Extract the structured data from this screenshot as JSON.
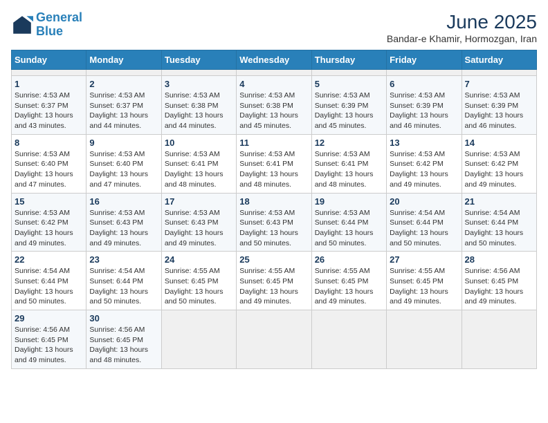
{
  "header": {
    "logo_line1": "General",
    "logo_line2": "Blue",
    "title": "June 2025",
    "subtitle": "Bandar-e Khamir, Hormozgan, Iran"
  },
  "calendar": {
    "days_of_week": [
      "Sunday",
      "Monday",
      "Tuesday",
      "Wednesday",
      "Thursday",
      "Friday",
      "Saturday"
    ],
    "weeks": [
      [
        {
          "day": "",
          "empty": true
        },
        {
          "day": "",
          "empty": true
        },
        {
          "day": "",
          "empty": true
        },
        {
          "day": "",
          "empty": true
        },
        {
          "day": "",
          "empty": true
        },
        {
          "day": "",
          "empty": true
        },
        {
          "day": "",
          "empty": true
        }
      ],
      [
        {
          "day": "1",
          "sunrise": "Sunrise: 4:53 AM",
          "sunset": "Sunset: 6:37 PM",
          "daylight": "Daylight: 13 hours and 43 minutes."
        },
        {
          "day": "2",
          "sunrise": "Sunrise: 4:53 AM",
          "sunset": "Sunset: 6:37 PM",
          "daylight": "Daylight: 13 hours and 44 minutes."
        },
        {
          "day": "3",
          "sunrise": "Sunrise: 4:53 AM",
          "sunset": "Sunset: 6:38 PM",
          "daylight": "Daylight: 13 hours and 44 minutes."
        },
        {
          "day": "4",
          "sunrise": "Sunrise: 4:53 AM",
          "sunset": "Sunset: 6:38 PM",
          "daylight": "Daylight: 13 hours and 45 minutes."
        },
        {
          "day": "5",
          "sunrise": "Sunrise: 4:53 AM",
          "sunset": "Sunset: 6:39 PM",
          "daylight": "Daylight: 13 hours and 45 minutes."
        },
        {
          "day": "6",
          "sunrise": "Sunrise: 4:53 AM",
          "sunset": "Sunset: 6:39 PM",
          "daylight": "Daylight: 13 hours and 46 minutes."
        },
        {
          "day": "7",
          "sunrise": "Sunrise: 4:53 AM",
          "sunset": "Sunset: 6:39 PM",
          "daylight": "Daylight: 13 hours and 46 minutes."
        }
      ],
      [
        {
          "day": "8",
          "sunrise": "Sunrise: 4:53 AM",
          "sunset": "Sunset: 6:40 PM",
          "daylight": "Daylight: 13 hours and 47 minutes."
        },
        {
          "day": "9",
          "sunrise": "Sunrise: 4:53 AM",
          "sunset": "Sunset: 6:40 PM",
          "daylight": "Daylight: 13 hours and 47 minutes."
        },
        {
          "day": "10",
          "sunrise": "Sunrise: 4:53 AM",
          "sunset": "Sunset: 6:41 PM",
          "daylight": "Daylight: 13 hours and 48 minutes."
        },
        {
          "day": "11",
          "sunrise": "Sunrise: 4:53 AM",
          "sunset": "Sunset: 6:41 PM",
          "daylight": "Daylight: 13 hours and 48 minutes."
        },
        {
          "day": "12",
          "sunrise": "Sunrise: 4:53 AM",
          "sunset": "Sunset: 6:41 PM",
          "daylight": "Daylight: 13 hours and 48 minutes."
        },
        {
          "day": "13",
          "sunrise": "Sunrise: 4:53 AM",
          "sunset": "Sunset: 6:42 PM",
          "daylight": "Daylight: 13 hours and 49 minutes."
        },
        {
          "day": "14",
          "sunrise": "Sunrise: 4:53 AM",
          "sunset": "Sunset: 6:42 PM",
          "daylight": "Daylight: 13 hours and 49 minutes."
        }
      ],
      [
        {
          "day": "15",
          "sunrise": "Sunrise: 4:53 AM",
          "sunset": "Sunset: 6:42 PM",
          "daylight": "Daylight: 13 hours and 49 minutes."
        },
        {
          "day": "16",
          "sunrise": "Sunrise: 4:53 AM",
          "sunset": "Sunset: 6:43 PM",
          "daylight": "Daylight: 13 hours and 49 minutes."
        },
        {
          "day": "17",
          "sunrise": "Sunrise: 4:53 AM",
          "sunset": "Sunset: 6:43 PM",
          "daylight": "Daylight: 13 hours and 49 minutes."
        },
        {
          "day": "18",
          "sunrise": "Sunrise: 4:53 AM",
          "sunset": "Sunset: 6:43 PM",
          "daylight": "Daylight: 13 hours and 50 minutes."
        },
        {
          "day": "19",
          "sunrise": "Sunrise: 4:53 AM",
          "sunset": "Sunset: 6:44 PM",
          "daylight": "Daylight: 13 hours and 50 minutes."
        },
        {
          "day": "20",
          "sunrise": "Sunrise: 4:54 AM",
          "sunset": "Sunset: 6:44 PM",
          "daylight": "Daylight: 13 hours and 50 minutes."
        },
        {
          "day": "21",
          "sunrise": "Sunrise: 4:54 AM",
          "sunset": "Sunset: 6:44 PM",
          "daylight": "Daylight: 13 hours and 50 minutes."
        }
      ],
      [
        {
          "day": "22",
          "sunrise": "Sunrise: 4:54 AM",
          "sunset": "Sunset: 6:44 PM",
          "daylight": "Daylight: 13 hours and 50 minutes."
        },
        {
          "day": "23",
          "sunrise": "Sunrise: 4:54 AM",
          "sunset": "Sunset: 6:44 PM",
          "daylight": "Daylight: 13 hours and 50 minutes."
        },
        {
          "day": "24",
          "sunrise": "Sunrise: 4:55 AM",
          "sunset": "Sunset: 6:45 PM",
          "daylight": "Daylight: 13 hours and 50 minutes."
        },
        {
          "day": "25",
          "sunrise": "Sunrise: 4:55 AM",
          "sunset": "Sunset: 6:45 PM",
          "daylight": "Daylight: 13 hours and 49 minutes."
        },
        {
          "day": "26",
          "sunrise": "Sunrise: 4:55 AM",
          "sunset": "Sunset: 6:45 PM",
          "daylight": "Daylight: 13 hours and 49 minutes."
        },
        {
          "day": "27",
          "sunrise": "Sunrise: 4:55 AM",
          "sunset": "Sunset: 6:45 PM",
          "daylight": "Daylight: 13 hours and 49 minutes."
        },
        {
          "day": "28",
          "sunrise": "Sunrise: 4:56 AM",
          "sunset": "Sunset: 6:45 PM",
          "daylight": "Daylight: 13 hours and 49 minutes."
        }
      ],
      [
        {
          "day": "29",
          "sunrise": "Sunrise: 4:56 AM",
          "sunset": "Sunset: 6:45 PM",
          "daylight": "Daylight: 13 hours and 49 minutes."
        },
        {
          "day": "30",
          "sunrise": "Sunrise: 4:56 AM",
          "sunset": "Sunset: 6:45 PM",
          "daylight": "Daylight: 13 hours and 48 minutes."
        },
        {
          "day": "",
          "empty": true
        },
        {
          "day": "",
          "empty": true
        },
        {
          "day": "",
          "empty": true
        },
        {
          "day": "",
          "empty": true
        },
        {
          "day": "",
          "empty": true
        }
      ]
    ]
  }
}
